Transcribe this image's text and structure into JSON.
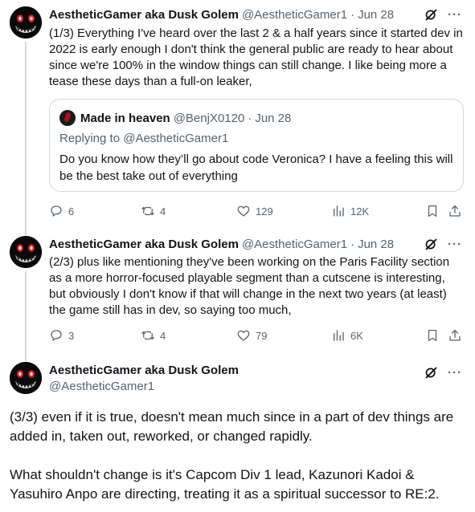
{
  "tweets": [
    {
      "name": "AestheticGamer aka Dusk Golem",
      "handle": "@AestheticGamer1",
      "dot": "·",
      "date": "Jun 28",
      "text": "(1/3) Everything I've heard over the last 2 & a half years since it started dev in 2022 is early enough I don't think the general public are ready to hear about since we're 100% in the window things can still change. I like being more a tease these days than a full-on leaker,",
      "quote": {
        "name": "Made in heaven",
        "handle": "@BenjX0120",
        "dot": "·",
        "date": "Jun 28",
        "replying_to": "Replying to @AestheticGamer1",
        "text": "Do you know how they’ll go about code Veronica? I have a feeling this will be the best take out of everything"
      },
      "stats": {
        "replies": "6",
        "reposts": "4",
        "likes": "129",
        "views": "12K"
      }
    },
    {
      "name": "AestheticGamer aka Dusk Golem",
      "handle": "@AestheticGamer1",
      "dot": "·",
      "date": "Jun 28",
      "text": "(2/3) plus like mentioning they've been working on the Paris Facility section as a more horror-focused playable segment than a cutscene is interesting, but obviously I don't know if that will change in the next two years (at least) the game still has in dev, so saying too much,",
      "stats": {
        "replies": "3",
        "reposts": "4",
        "likes": "79",
        "views": "6K"
      }
    },
    {
      "name": "AestheticGamer aka Dusk Golem",
      "handle": "@AestheticGamer1",
      "paragraphs": [
        "(3/3) even if it is true, doesn't mean much since in a part of dev things are added in, taken out, reworked, or changed rapidly.",
        "What shouldn't change is it's Capcom Div 1 lead, Kazunori Kadoi & Yasuhiro Anpo are directing, treating it as a spiritual successor to RE:2."
      ]
    }
  ],
  "icons": [
    "grok-icon",
    "more-icon",
    "reply-icon",
    "repost-icon",
    "like-icon",
    "views-icon",
    "bookmark-icon",
    "share-icon"
  ],
  "colors": {
    "text": "#0f1419",
    "secondary": "#536471",
    "border": "#cfd9de",
    "avatar_bg": "#0a0a0a"
  }
}
